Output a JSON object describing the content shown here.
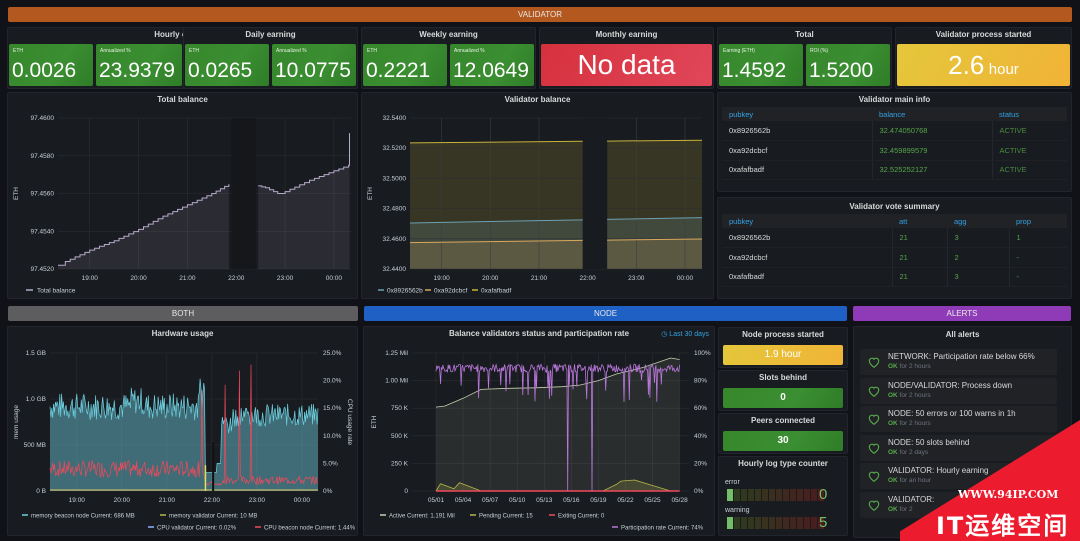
{
  "banners": {
    "validator": {
      "label": "VALIDATOR",
      "color": "#b3581f"
    },
    "both": {
      "label": "BOTH",
      "color": "#5d5d5f"
    },
    "node": {
      "label": "NODE",
      "color": "#1f60c4"
    },
    "alerts": {
      "label": "ALERTS",
      "color": "#8f3bb8"
    }
  },
  "stats": {
    "hourly": {
      "title": "Hourly earning",
      "eth_label": "ETH",
      "eth": "0.0026",
      "ann_label": "Annualized %",
      "ann": "23.9379"
    },
    "daily": {
      "title": "Daily earning",
      "eth_label": "ETH",
      "eth": "0.0265",
      "ann_label": "Annualized %",
      "ann": "10.0775"
    },
    "weekly": {
      "title": "Weekly earning",
      "eth_label": "ETH",
      "eth": "0.2221",
      "ann_label": "Annualized %",
      "ann": "12.0649"
    },
    "monthly": {
      "title": "Monthly earning",
      "value": "No data"
    },
    "total": {
      "title": "Total",
      "earn_label": "Earning (ETH)",
      "earn": "1.4592",
      "roi_label": "ROI (%)",
      "roi": "1.5200"
    },
    "validator_started": {
      "title": "Validator process started",
      "value": "2.6",
      "unit": "hour"
    }
  },
  "validator_main_info": {
    "title": "Validator main info",
    "columns": [
      "pubkey",
      "balance",
      "status"
    ],
    "rows": [
      [
        "0x8926562b",
        "32.474050768",
        "ACTIVE"
      ],
      [
        "0xa92dcbcf",
        "32.459899579",
        "ACTIVE"
      ],
      [
        "0xafafbadf",
        "32.525252127",
        "ACTIVE"
      ]
    ]
  },
  "validator_vote_summary": {
    "title": "Validator vote summary",
    "columns": [
      "pubkey",
      "att",
      "agg",
      "prop"
    ],
    "rows": [
      [
        "0x8926562b",
        "21",
        "3",
        "1"
      ],
      [
        "0xa92dcbcf",
        "21",
        "2",
        "-"
      ],
      [
        "0xafafbadf",
        "21",
        "3",
        "-"
      ]
    ]
  },
  "node": {
    "process_started": {
      "title": "Node process started",
      "value": "1.9 hour"
    },
    "slots_behind": {
      "title": "Slots behind",
      "value": "0"
    },
    "peers": {
      "title": "Peers connected",
      "value": "30"
    },
    "log_counter": {
      "title": "Hourly log type counter",
      "items": [
        {
          "label": "error",
          "value": "0",
          "fraction": 0.05
        },
        {
          "label": "warning",
          "value": "5",
          "fraction": 0.05
        }
      ]
    }
  },
  "alerts": {
    "title": "All alerts",
    "items": [
      {
        "name": "NETWORK: Participation rate below 66%",
        "state": "OK",
        "since": "for 2 hours"
      },
      {
        "name": "NODE/VALIDATOR: Process down",
        "state": "OK",
        "since": "for 2 hours"
      },
      {
        "name": "NODE: 50 errors or 100 warns in 1h",
        "state": "OK",
        "since": "for 2 hours"
      },
      {
        "name": "NODE: 50 slots behind",
        "state": "OK",
        "since": "for 2 days"
      },
      {
        "name": "VALIDATOR: Hourly earning",
        "state": "OK",
        "since": "for an hour"
      },
      {
        "name": "VALIDATOR: ",
        "state": "OK",
        "since": "for 2"
      }
    ]
  },
  "watermark": {
    "line1": "WWW.94IP.COM",
    "line2": "IT运维空间"
  },
  "chart_data": [
    {
      "id": "total_balance",
      "type": "line",
      "title": "Total balance",
      "ylabel": "ETH",
      "xlabel": "",
      "ylim": [
        97.452,
        97.46
      ],
      "yticks": [
        "97.4520",
        "97.4540",
        "97.4560",
        "97.4580",
        "97.4600"
      ],
      "xticks": [
        "19:00",
        "20:00",
        "21:00",
        "22:00",
        "23:00",
        "00:00"
      ],
      "xrange_hours": [
        18.35,
        24.35
      ],
      "gap_hours": [
        21.9,
        22.4
      ],
      "series": [
        {
          "name": "Total balance",
          "color": "#b6a9c9",
          "points": [
            [
              18.35,
              97.4522
            ],
            [
              18.5,
              97.4524
            ],
            [
              19.0,
              97.453
            ],
            [
              19.5,
              97.4535
            ],
            [
              20.0,
              97.4541
            ],
            [
              20.5,
              97.4548
            ],
            [
              21.0,
              97.4554
            ],
            [
              21.5,
              97.456
            ],
            [
              21.85,
              97.4565
            ],
            [
              22.45,
              97.4564
            ],
            [
              22.6,
              97.4563
            ],
            [
              22.85,
              97.456
            ],
            [
              23.0,
              97.4561
            ],
            [
              23.5,
              97.4567
            ],
            [
              24.0,
              97.4572
            ],
            [
              24.3,
              97.4575
            ],
            [
              24.32,
              97.4592
            ]
          ]
        }
      ],
      "legend": [
        {
          "label": "Total balance",
          "color": "#b6a9c9"
        }
      ]
    },
    {
      "id": "validator_balance",
      "type": "area",
      "title": "Validator balance",
      "ylabel": "ETH",
      "ylim": [
        32.44,
        32.54
      ],
      "yticks": [
        "32.4400",
        "32.4600",
        "32.4800",
        "32.5000",
        "32.5200",
        "32.5400"
      ],
      "xticks": [
        "19:00",
        "20:00",
        "21:00",
        "22:00",
        "23:00",
        "00:00"
      ],
      "xrange_hours": [
        18.35,
        24.35
      ],
      "gap_hours": [
        21.9,
        22.4
      ],
      "series": [
        {
          "name": "0x8926562b",
          "color": "#6d9fb0",
          "start": 32.4705,
          "end": 32.474
        },
        {
          "name": "0xa92dcbcf",
          "color": "#d9a85c",
          "start": 32.4575,
          "end": 32.4599
        },
        {
          "name": "0xafafbadf",
          "color": "#c8b23c",
          "start": 32.5235,
          "end": 32.5253
        }
      ],
      "legend": [
        {
          "label": "0x8926562b",
          "color": "#6d9fb0"
        },
        {
          "label": "0xa92dcbcf",
          "color": "#d9a85c"
        },
        {
          "label": "0xafafbadf",
          "color": "#c8b23c"
        }
      ]
    },
    {
      "id": "hardware_usage",
      "type": "area",
      "title": "Hardware usage",
      "ylabel": "mem usage",
      "y2label": "CPU usage rate",
      "yticks": [
        "0 B",
        "500 MB",
        "1.0 GB",
        "1.5 GB"
      ],
      "y2ticks": [
        "0%",
        "5.0%",
        "10.0%",
        "15.0%",
        "20.0%",
        "25.0%"
      ],
      "ylim_mb": [
        0,
        1500
      ],
      "y2lim": [
        0,
        25
      ],
      "xticks": [
        "19:00",
        "20:00",
        "21:00",
        "22:00",
        "23:00",
        "00:00"
      ],
      "series": [
        {
          "name": "memory beacon node",
          "color": "#6ed0e0",
          "current": "686 MB",
          "level_mb": 950,
          "after_restart_mb": 800
        },
        {
          "name": "memory validator",
          "color": "#e0c860",
          "current": "10 MB"
        },
        {
          "name": "CPU validator",
          "color": "#8ab8ff",
          "current": "0.02%"
        },
        {
          "name": "CPU beacon node",
          "color": "#f2495c",
          "current": "1.44%",
          "level_pct": 3.5
        }
      ],
      "legend": [
        {
          "label": "memory beacon node  Current: 686 MB",
          "color": "#6ed0e0"
        },
        {
          "label": "memory validator  Current: 10 MB",
          "color": "#b7b74a"
        },
        {
          "label": "CPU validator  Current: 0.02%",
          "color": "#8ab8ff"
        },
        {
          "label": "CPU beacon node  Current: 1.44%",
          "color": "#f2495c"
        }
      ]
    },
    {
      "id": "participation",
      "type": "line",
      "title": "Balance validators status and participation rate",
      "time_range": "Last 30 days",
      "ylabel": "ETH",
      "yticks": [
        "0",
        "250 K",
        "500 K",
        "750 K",
        "1.00 Mil",
        "1.25 Mil"
      ],
      "y2ticks": [
        "0%",
        "20%",
        "40%",
        "60%",
        "80%",
        "100%"
      ],
      "ylim": [
        0,
        1250000
      ],
      "y2lim": [
        0,
        100
      ],
      "xticks": [
        "05/01",
        "05/04",
        "05/07",
        "05/10",
        "05/13",
        "05/16",
        "05/19",
        "05/22",
        "05/25",
        "05/28"
      ],
      "series": [
        {
          "name": "Active",
          "color": "#c8d0b0",
          "current": "1.191 Mil",
          "points": [
            [
              0,
              760000
            ],
            [
              1,
              770000
            ],
            [
              3,
              840000
            ],
            [
              5,
              920000
            ],
            [
              8,
              930000
            ],
            [
              11,
              935000
            ],
            [
              14,
              945000
            ],
            [
              16,
              960000
            ],
            [
              18,
              1000000
            ],
            [
              20,
              1060000
            ],
            [
              23,
              1120000
            ],
            [
              26,
              1205000
            ],
            [
              27,
              1191000
            ]
          ]
        },
        {
          "name": "Pending",
          "color": "#b7b74a",
          "current": "15",
          "points": [
            [
              0,
              0
            ],
            [
              0.5,
              65000
            ],
            [
              2,
              20000
            ],
            [
              2.6,
              75000
            ],
            [
              5,
              0
            ],
            [
              18.5,
              0
            ],
            [
              20,
              60000
            ],
            [
              20.5,
              90000
            ],
            [
              22,
              100000
            ],
            [
              24,
              50000
            ],
            [
              26,
              0
            ],
            [
              27,
              15
            ]
          ]
        },
        {
          "name": "Exiting",
          "color": "#f2495c",
          "current": "0",
          "points": [
            [
              0,
              0
            ],
            [
              27,
              0
            ]
          ]
        },
        {
          "name": "Participation rate",
          "color": "#b877d9",
          "current": "74%",
          "level_pct": 88
        }
      ],
      "legend": [
        {
          "label": "Active  Current: 1.191 Mil",
          "color": "#c8d0b0"
        },
        {
          "label": "Pending  Current: 15",
          "color": "#b7b74a"
        },
        {
          "label": "Exiting  Current: 0",
          "color": "#f2495c"
        },
        {
          "label": "Participation rate  Current: 74%",
          "color": "#b877d9"
        }
      ]
    }
  ]
}
